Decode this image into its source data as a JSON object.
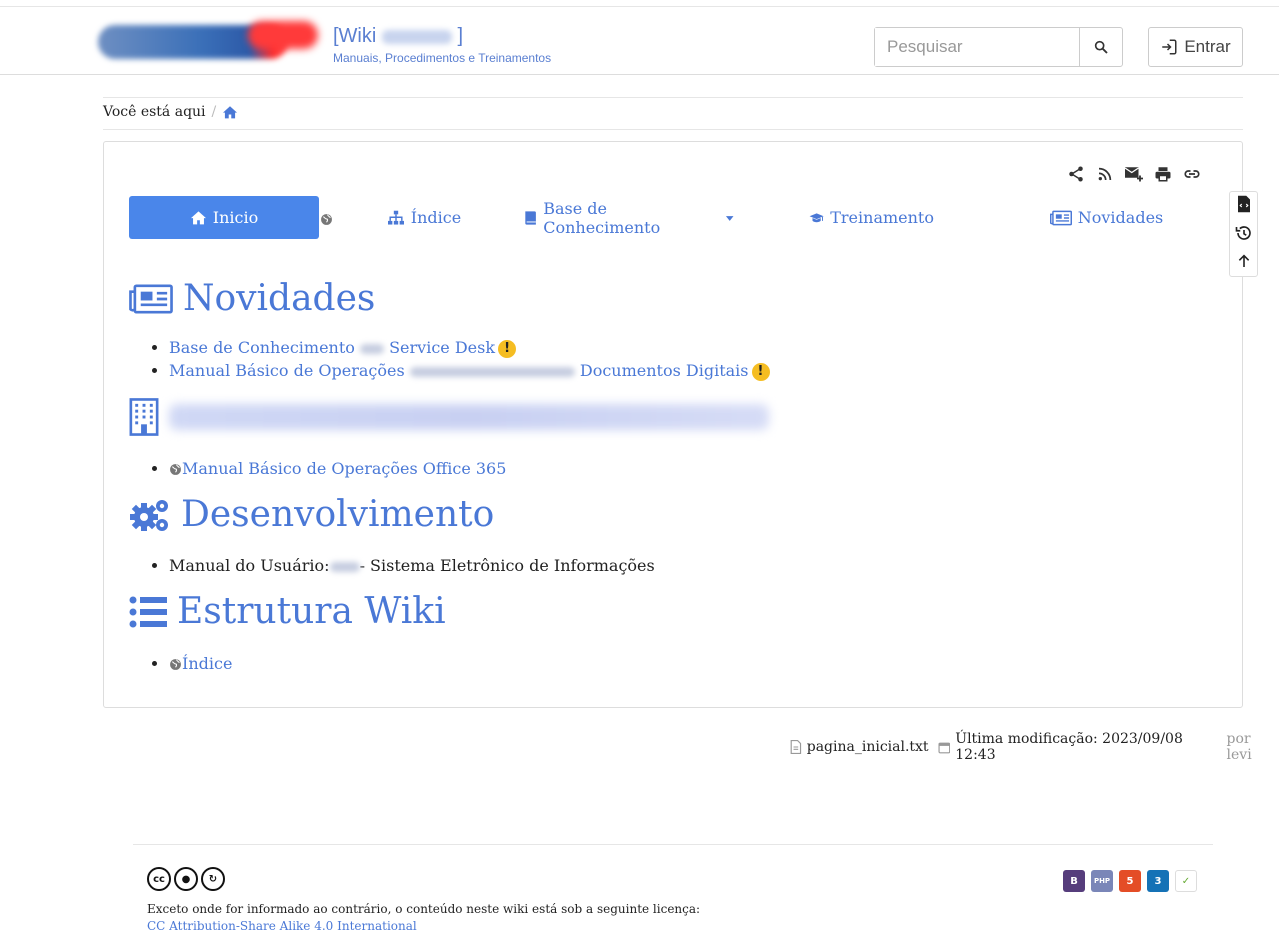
{
  "header": {
    "site_title_prefix": "[Wiki",
    "site_title_suffix": "]",
    "site_subtitle": "Manuais, Procedimentos e Treinamentos",
    "search_placeholder": "Pesquisar",
    "login_label": "Entrar"
  },
  "breadcrumb": {
    "label": "Você está aqui",
    "separator": "/"
  },
  "nav": {
    "items": [
      {
        "label": "Inicio",
        "icon": "home-icon"
      },
      {
        "label": "Índice",
        "icon": "sitemap-icon"
      },
      {
        "label": "Base de Conhecimento",
        "icon": "book-icon"
      },
      {
        "label": "Treinamento",
        "icon": "graduation-cap-icon"
      },
      {
        "label": "Novidades",
        "icon": "newspaper-icon"
      }
    ]
  },
  "sections": {
    "novidades": {
      "title": "Novidades",
      "items": [
        {
          "before": "Base de Conhecimento",
          "after": "Service Desk"
        },
        {
          "before": "Manual Básico de Operações",
          "after": "Documentos Digitais"
        }
      ]
    },
    "redacted": {
      "items": [
        {
          "label": "Manual Básico de Operações Office 365"
        }
      ]
    },
    "desenvolvimento": {
      "title": "Desenvolvimento",
      "items": [
        {
          "before": "Manual do Usuário:",
          "after": "- Sistema Eletrônico de Informações"
        }
      ]
    },
    "estrutura": {
      "title": "Estrutura Wiki",
      "items": [
        {
          "label": "Índice"
        }
      ]
    }
  },
  "page_meta": {
    "filename": "pagina_inicial.txt",
    "last_modified": "Última modificação: 2023/09/08 12:43",
    "by": "por levi"
  },
  "footer": {
    "license_text": "Exceto onde for informado ao contrário, o conteúdo neste wiki está sob a seguinte licença:",
    "license_link": "CC Attribution-Share Alike 4.0 International",
    "badges": [
      "B",
      "PHP",
      "5",
      "3",
      "✓"
    ]
  },
  "colors": {
    "accent": "#4a86ea",
    "link": "#4a78d6",
    "warning": "#f5bd22"
  }
}
